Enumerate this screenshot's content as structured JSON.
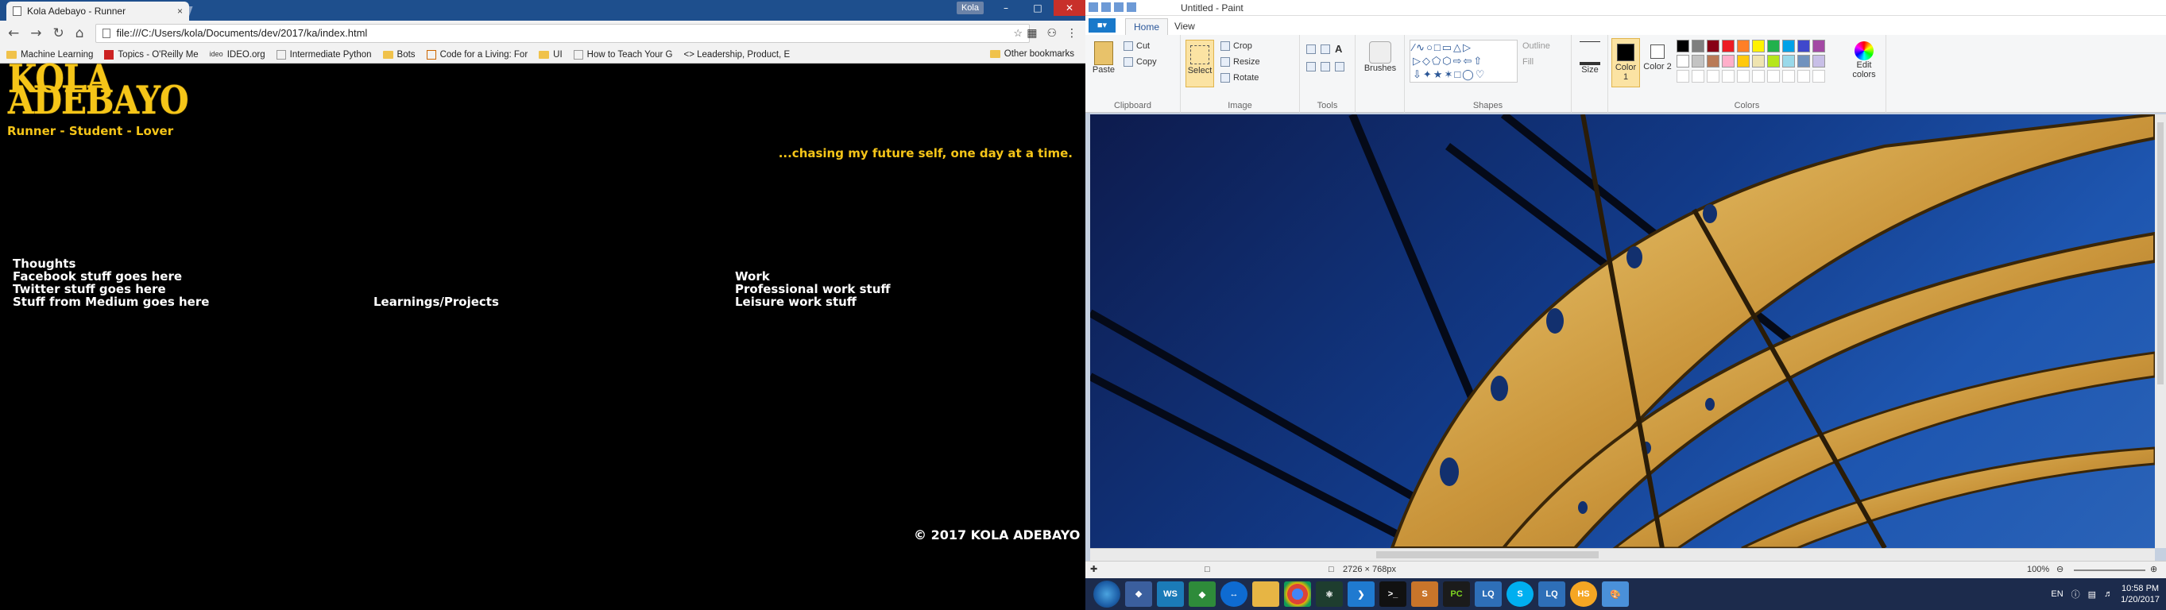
{
  "chrome": {
    "tab_title": "Kola Adebayo - Runner",
    "tab_close": "×",
    "user": "Kola",
    "url": "file:///C:/Users/kola/Documents/dev/2017/ka/index.html",
    "bookmarks": [
      {
        "label": "Machine Learning",
        "icon": "folder-icon"
      },
      {
        "label": "Topics - O'Reilly Me",
        "icon": "oreilly-icon"
      },
      {
        "label": "IDEO.org",
        "icon": "ideo-icon"
      },
      {
        "label": "Intermediate Python",
        "icon": "page-icon"
      },
      {
        "label": "Bots",
        "icon": "folder-icon"
      },
      {
        "label": "Code for a Living: For",
        "icon": "page-icon"
      },
      {
        "label": "UI",
        "icon": "folder-icon"
      },
      {
        "label": "How to Teach Your G",
        "icon": "page-icon"
      },
      {
        "label": "<> Leadership, Product, E",
        "icon": "code-icon"
      }
    ],
    "other_bookmarks": "Other bookmarks"
  },
  "site": {
    "name_line1": "KOLA",
    "name_line2": "ADEBAYO",
    "tagline": "Runner - Student - Lover",
    "slogan": "...chasing my future self, one day at a time.",
    "col1": [
      "Thoughts",
      "Facebook stuff goes here",
      "Twitter stuff goes here",
      "Stuff from Medium goes here"
    ],
    "col2": "Learnings/Projects",
    "col3": [
      "Work",
      "Professional work stuff",
      "Leisure work stuff"
    ],
    "footer": "© 2017 KOLA ADEBAYO"
  },
  "paint": {
    "title": "Untitled - Paint",
    "tabs": [
      "Home",
      "View"
    ],
    "clipboard": {
      "paste": "Paste",
      "cut": "Cut",
      "copy": "Copy",
      "label": "Clipboard"
    },
    "image": {
      "select": "Select",
      "crop": "Crop",
      "resize": "Resize",
      "rotate": "Rotate",
      "label": "Image"
    },
    "tools_label": "Tools",
    "brushes": "Brushes",
    "shapes": {
      "outline": "Outline",
      "fill": "Fill",
      "label": "Shapes"
    },
    "size": "Size",
    "color1": "Color 1",
    "color2": "Color 2",
    "colors_label": "Colors",
    "edit_colors": "Edit colors",
    "palette": [
      "#000000",
      "#7f7f7f",
      "#880015",
      "#ed1c24",
      "#ff7f27",
      "#fff200",
      "#22b14c",
      "#00a2e8",
      "#3f48cc",
      "#a349a4",
      "#ffffff",
      "#c3c3c3",
      "#b97a57",
      "#ffaec9",
      "#ffc90e",
      "#efe4b0",
      "#b5e61d",
      "#99d9ea",
      "#7092be",
      "#c8bfe7"
    ],
    "status_size": "2726 × 768px",
    "zoom": "100%"
  },
  "taskbar": {
    "apps": [
      "explorer-icon",
      "ws-icon",
      "pycharm-green-icon",
      "teamviewer-icon",
      "folder-icon",
      "chrome-icon",
      "atom-icon",
      "vscode-icon",
      "cmd-icon",
      "sublime-icon",
      "pc-icon",
      "lq-icon",
      "skype-icon",
      "lq2-icon",
      "hs-icon",
      "paint-icon"
    ],
    "lang": "EN",
    "time": "10:58 PM",
    "date": "1/20/2017"
  }
}
